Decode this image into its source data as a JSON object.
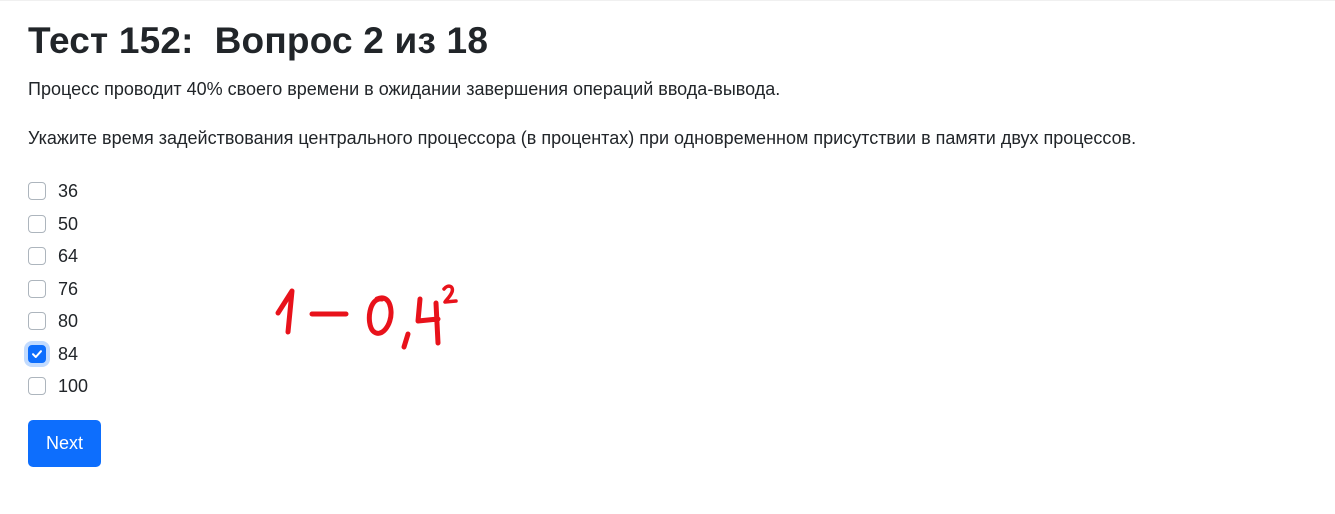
{
  "page": {
    "title": "Тест 152:  Вопрос 2 из 18",
    "question_line1": "Процесс проводит 40% своего времени в ожидании завершения операций ввода-вывода.",
    "question_line2": "Укажите время задействования центрального процессора (в процентах) при одновременном присутствии в памяти двух процессов."
  },
  "options": [
    {
      "label": "36",
      "checked": false
    },
    {
      "label": "50",
      "checked": false
    },
    {
      "label": "64",
      "checked": false
    },
    {
      "label": "76",
      "checked": false
    },
    {
      "label": "80",
      "checked": false
    },
    {
      "label": "84",
      "checked": true
    },
    {
      "label": "100",
      "checked": false
    }
  ],
  "next_button": {
    "label": "Next"
  },
  "handwritten_annotation": {
    "text": "1 − 0,4²",
    "color": "#e8121b"
  },
  "colors": {
    "accent": "#0d6efd",
    "text": "#212529",
    "checkbox_border": "#adb5bd"
  }
}
